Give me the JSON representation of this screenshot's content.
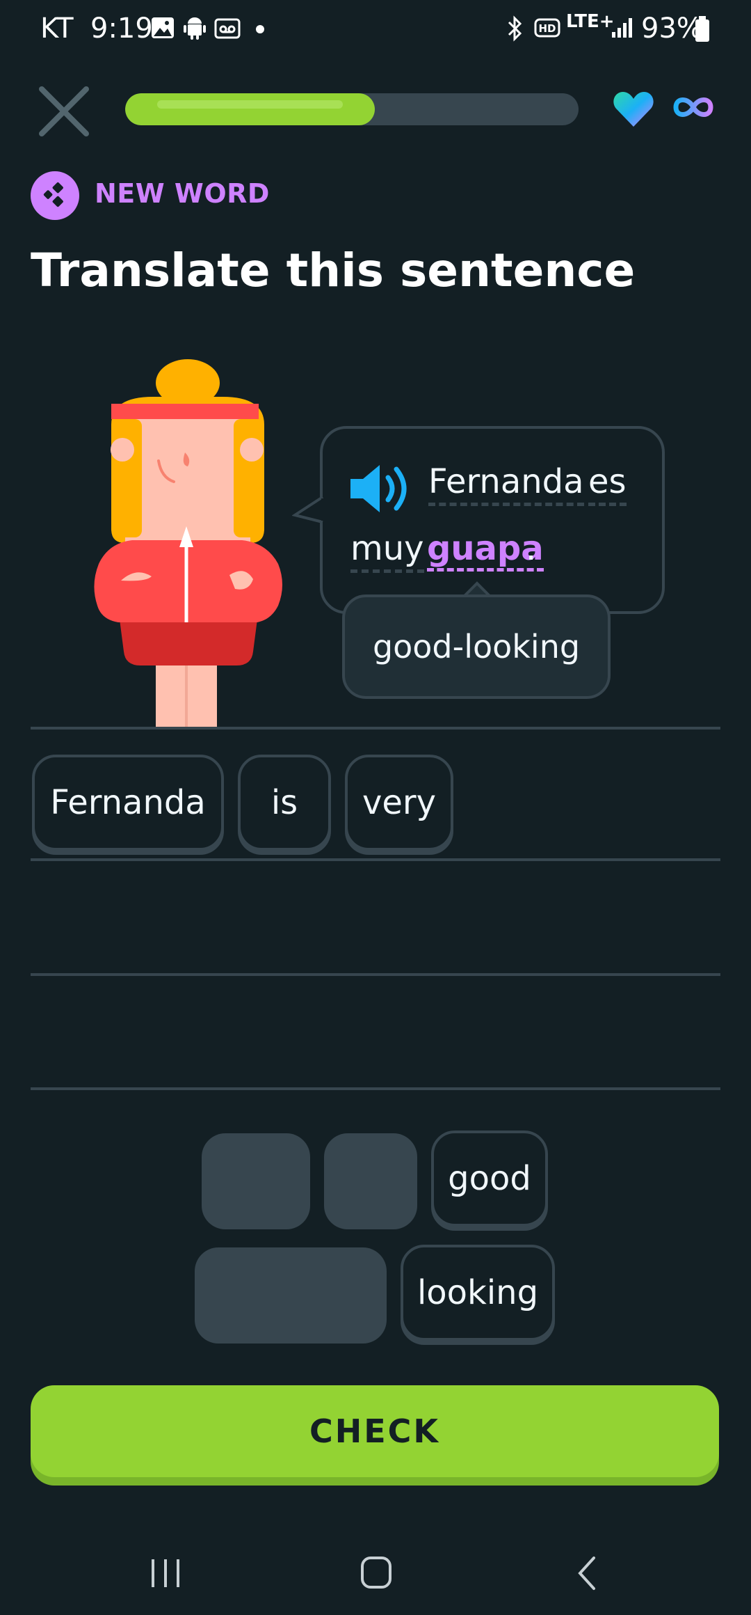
{
  "status_bar": {
    "carrier": "KT",
    "time": "9:19",
    "network": "LTE+",
    "battery": "93%"
  },
  "header": {
    "progress_fraction": 0.55
  },
  "lesson": {
    "badge": "NEW WORD",
    "title": "Translate this sentence"
  },
  "speech_bubble": {
    "words": [
      "Fernanda",
      "es",
      "muy",
      "guapa",
      "."
    ],
    "tooltip": "good-looking"
  },
  "answer_tiles": [
    "Fernanda",
    "is",
    "very"
  ],
  "word_bank": {
    "tiles": [
      "good",
      "looking"
    ]
  },
  "check_button": "CHECK",
  "colors": {
    "background": "#131f24",
    "accent_green": "#93d333",
    "purple": "#ce82ff",
    "tile_border": "#37464f",
    "speaker_blue": "#1cb0f6"
  }
}
